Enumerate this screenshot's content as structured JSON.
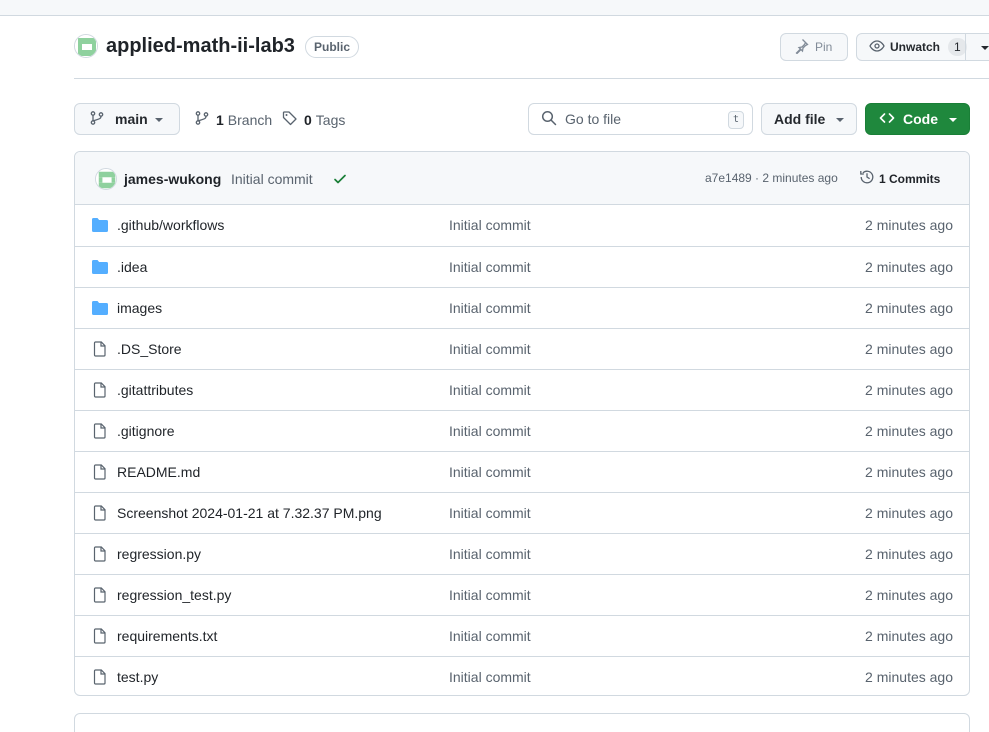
{
  "repo": {
    "name": "applied-math-ii-lab3",
    "visibility": "Public",
    "pin_label": "Pin",
    "watch_label": "Unwatch",
    "watch_count": "1"
  },
  "toolbar": {
    "branch": "main",
    "branch_count": "1",
    "branch_label": "Branch",
    "tag_count": "0",
    "tag_label": "Tags",
    "search_placeholder": "Go to file",
    "search_shortcut": "t",
    "add_file_label": "Add file",
    "code_label": "Code"
  },
  "latest_commit": {
    "author": "james-wukong",
    "message": "Initial commit",
    "sha_time": "a7e1489 · 2 minutes ago",
    "commits_label": "1 Commits"
  },
  "files": [
    {
      "type": "dir",
      "icon": "folder-icon",
      "name": ".github/workflows",
      "message": "Initial commit",
      "time": "2 minutes ago"
    },
    {
      "type": "dir",
      "icon": "folder-icon",
      "name": ".idea",
      "message": "Initial commit",
      "time": "2 minutes ago"
    },
    {
      "type": "dir",
      "icon": "folder-icon",
      "name": "images",
      "message": "Initial commit",
      "time": "2 minutes ago"
    },
    {
      "type": "file",
      "icon": "file-icon",
      "name": ".DS_Store",
      "message": "Initial commit",
      "time": "2 minutes ago"
    },
    {
      "type": "file",
      "icon": "file-icon",
      "name": ".gitattributes",
      "message": "Initial commit",
      "time": "2 minutes ago"
    },
    {
      "type": "file",
      "icon": "file-icon",
      "name": ".gitignore",
      "message": "Initial commit",
      "time": "2 minutes ago"
    },
    {
      "type": "file",
      "icon": "file-icon",
      "name": "README.md",
      "message": "Initial commit",
      "time": "2 minutes ago"
    },
    {
      "type": "file",
      "icon": "file-icon",
      "name": "Screenshot 2024-01-21 at 7.32.37 PM.png",
      "message": "Initial commit",
      "time": "2 minutes ago"
    },
    {
      "type": "file",
      "icon": "file-icon",
      "name": "regression.py",
      "message": "Initial commit",
      "time": "2 minutes ago"
    },
    {
      "type": "file",
      "icon": "file-icon",
      "name": "regression_test.py",
      "message": "Initial commit",
      "time": "2 minutes ago"
    },
    {
      "type": "file",
      "icon": "file-icon",
      "name": "requirements.txt",
      "message": "Initial commit",
      "time": "2 minutes ago"
    },
    {
      "type": "file",
      "icon": "file-icon",
      "name": "test.py",
      "message": "Initial commit",
      "time": "2 minutes ago"
    }
  ],
  "colors": {
    "primary_button": "#1f883d",
    "folder": "#54aeff",
    "success_check": "#1a7f37",
    "muted_text": "#59636e",
    "border": "#d1d9e0"
  }
}
